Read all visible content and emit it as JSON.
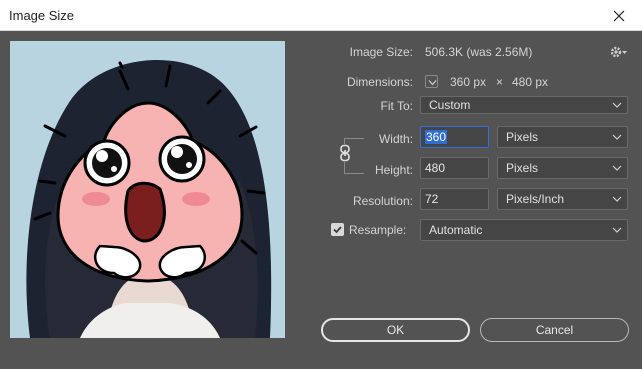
{
  "window": {
    "title": "Image Size"
  },
  "info": {
    "image_size_label": "Image Size:",
    "image_size_value": "506.3K (was 2.56M)",
    "dimensions_label": "Dimensions:",
    "dimensions_width": "360 px",
    "dimensions_sep": "×",
    "dimensions_height": "480 px"
  },
  "fit_to": {
    "label": "Fit To:",
    "value": "Custom"
  },
  "width": {
    "label": "Width:",
    "value": "360",
    "unit": "Pixels"
  },
  "height": {
    "label": "Height:",
    "value": "480",
    "unit": "Pixels"
  },
  "resolution": {
    "label": "Resolution:",
    "value": "72",
    "unit": "Pixels/Inch"
  },
  "resample": {
    "label": "Resample:",
    "checked": true,
    "value": "Automatic"
  },
  "buttons": {
    "ok": "OK",
    "cancel": "Cancel"
  },
  "icons": {
    "close": "close-icon",
    "gear": "gear-icon",
    "link": "link-icon",
    "chevron": "chevron-down-icon",
    "check": "checkmark-icon"
  }
}
